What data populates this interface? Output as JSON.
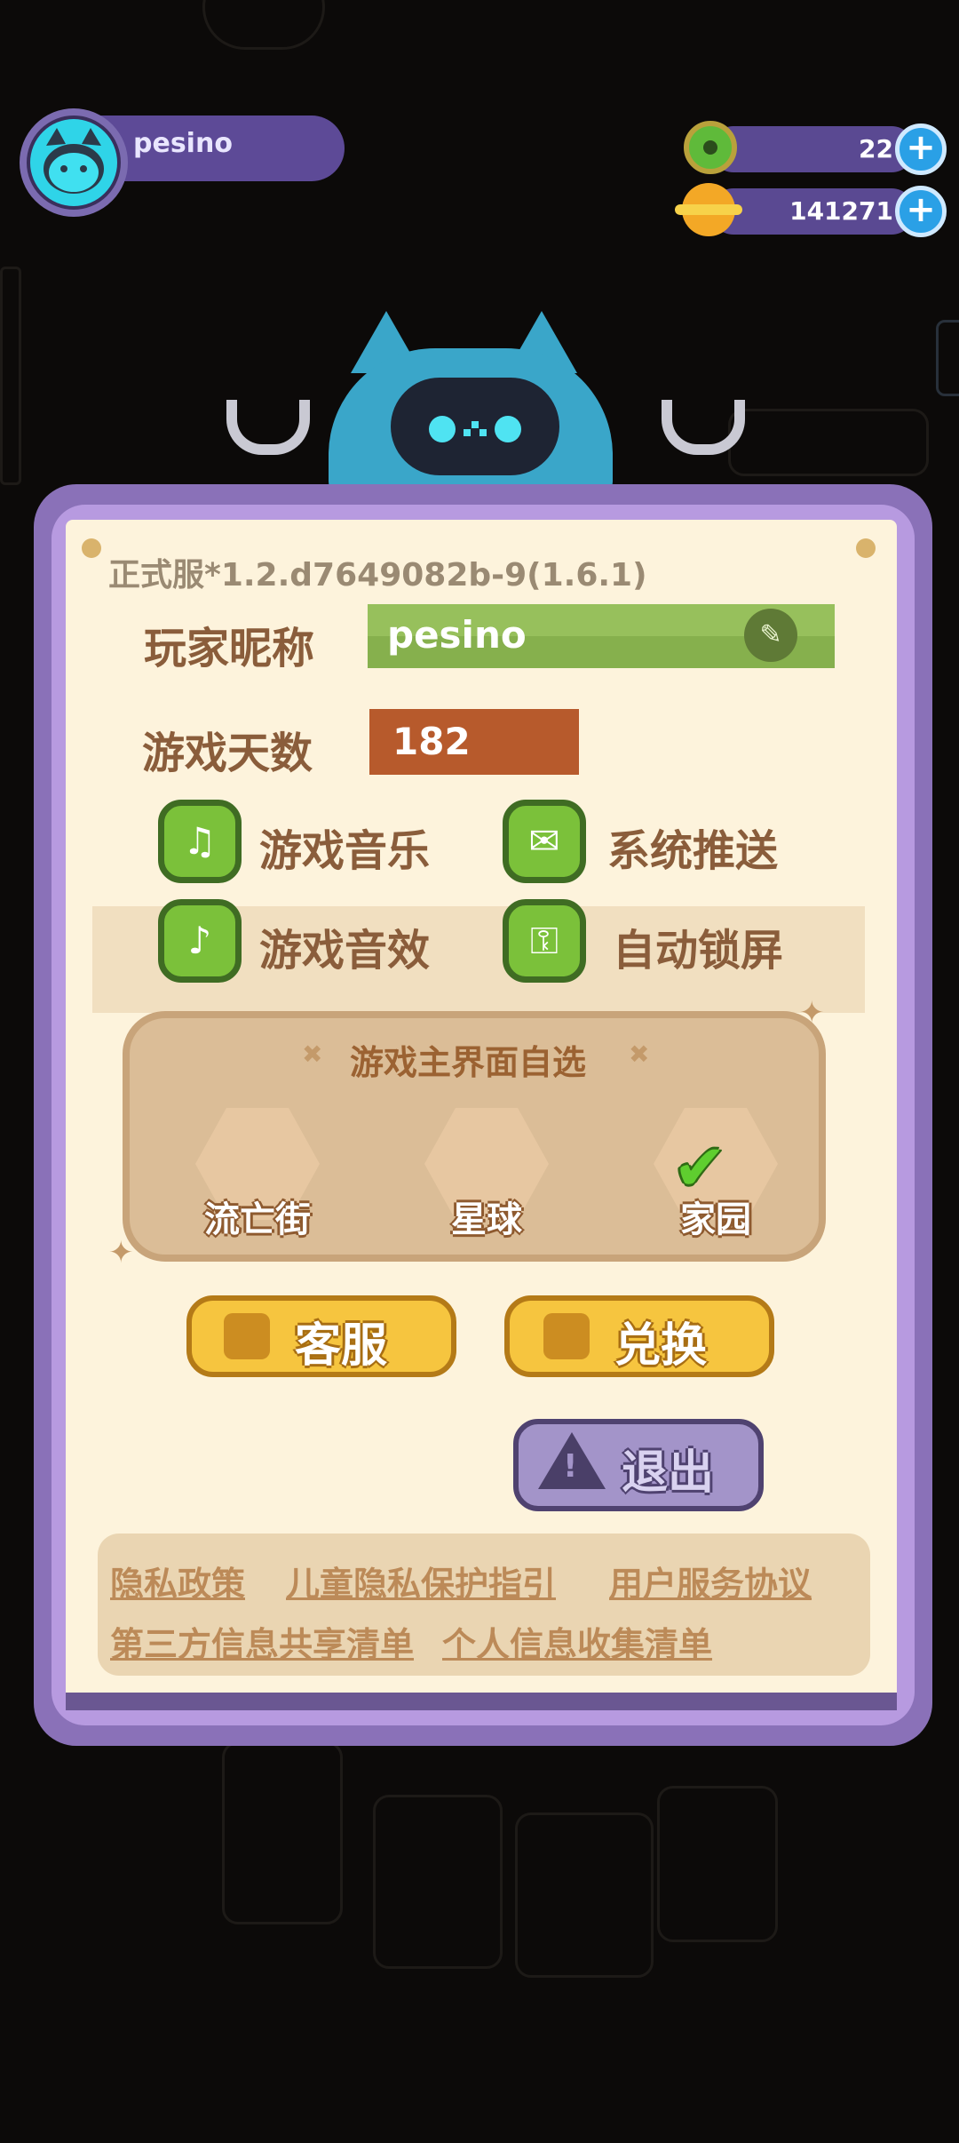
{
  "header": {
    "player_name": "pesino",
    "currency": [
      {
        "icon": "green-donut-coin-icon",
        "value": "22"
      },
      {
        "icon": "planet-coin-icon",
        "value": "141271"
      }
    ],
    "plus_symbol": "+"
  },
  "settings": {
    "version": "正式服*1.2.d7649082b-9(1.6.1)",
    "nickname_label": "玩家昵称",
    "nickname_value": "pesino",
    "days_label": "游戏天数",
    "days_value": "182",
    "toggles": [
      {
        "icon": "music-note-icon",
        "label": "游戏音乐"
      },
      {
        "icon": "envelope-icon",
        "label": "系统推送"
      },
      {
        "icon": "speaker-icon",
        "label": "游戏音效"
      },
      {
        "icon": "lock-icon",
        "label": "自动锁屏"
      }
    ],
    "main_screen": {
      "title": "游戏主界面自选",
      "options": [
        {
          "icon": "hut-icon",
          "label": "流亡街"
        },
        {
          "icon": "planet-face-icon",
          "label": "星球"
        },
        {
          "icon": "cat-home-icon",
          "label": "家园",
          "selected": true
        }
      ]
    },
    "buttons": {
      "support": "客服",
      "redeem": "兑换",
      "logout": "退出"
    },
    "links": [
      "隐私政策",
      "儿童隐私保护指引",
      "用户服务协议",
      "第三方信息共享清单",
      "个人信息收集清单"
    ]
  },
  "colors": {
    "panel_frame": "#8a71b8",
    "paper": "#fdf3dc",
    "toggle_green": "#7bc13a",
    "nickname_green": "#86b04d",
    "days_orange": "#b75a2c",
    "gold_button": "#f6c53f",
    "logout_purple": "#a394c9"
  }
}
